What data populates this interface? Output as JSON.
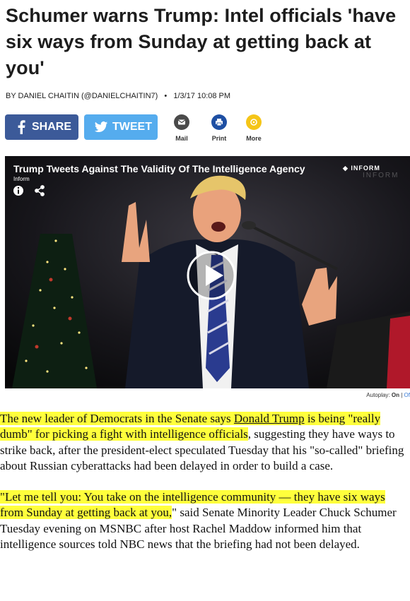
{
  "article": {
    "headline": "Schumer warns Trump: Intel officials 'have six ways from Sunday at getting back at you'",
    "byline_prefix": "By",
    "author": "DANIEL CHAITIN (@DANIELCHAITIN7)",
    "date": "1/3/17 10:08 PM"
  },
  "share": {
    "facebook_label": "SHARE",
    "twitter_label": "TWEET",
    "mail_label": "Mail",
    "print_label": "Print",
    "more_label": "More",
    "colors": {
      "facebook": "#3c5a99",
      "twitter": "#55acee",
      "mail": "#4a4a4a",
      "print": "#1e4fa3",
      "more": "#f5c518"
    }
  },
  "video": {
    "title": "Trump Tweets Against The Validity Of The Intelligence Agency",
    "source": "Inform",
    "brand": "INFORM",
    "brand_ghost": "INFORM",
    "autoplay_label": "Autoplay:",
    "autoplay_on": "On",
    "autoplay_sep": "|",
    "autoplay_off": "Of"
  },
  "body": {
    "p1_hl1": "The new leader of Democrats in the Senate says ",
    "p1_link": "Donald Trump",
    "p1_hl2": " is being \"really dumb\" for picking a fight with intelligence officials",
    "p1_rest": ", suggesting they have ways to strike back, after the president-elect speculated Tuesday that his \"so-called\" briefing about Russian cyberattacks had been delayed in order to build a case.",
    "p2_hl": "\"Let me tell you: You take on the intelligence community — they have six ways from Sunday at getting back at you,",
    "p2_rest": "\" said Senate Minority Leader Chuck Schumer Tuesday evening on MSNBC after host Rachel Maddow informed him that intelligence sources told NBC news that the briefing had not been delayed."
  },
  "highlight_color": "#ffff3c"
}
